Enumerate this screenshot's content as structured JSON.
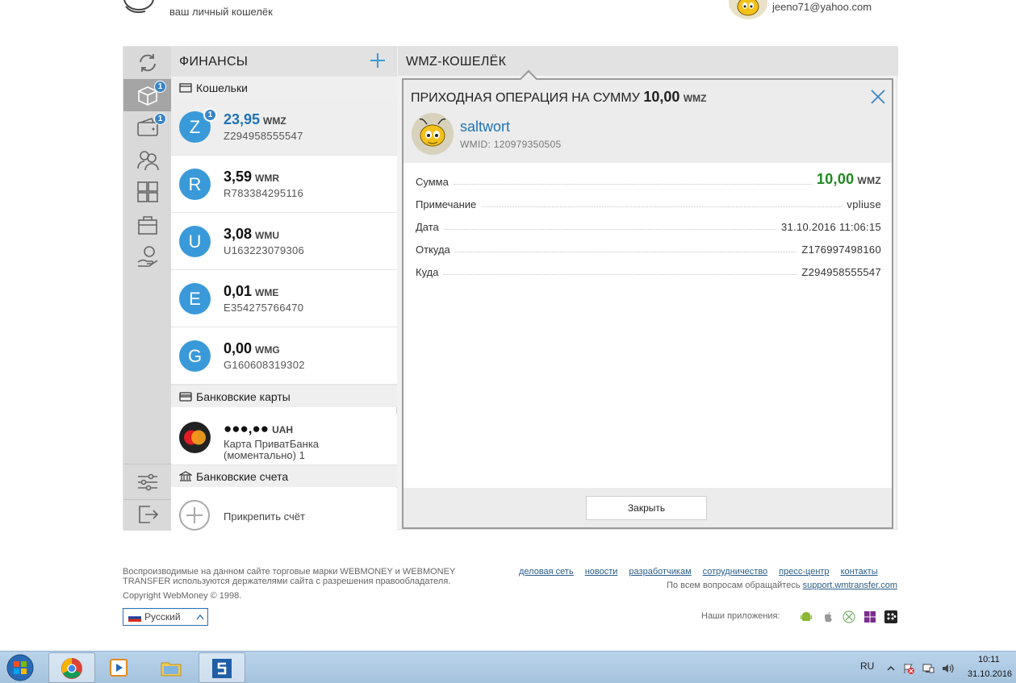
{
  "header": {
    "logo_subtitle": "ваш личный кошелёк",
    "user_email": "jeeno71@yahoo.com"
  },
  "left_bar": {
    "items": [
      {
        "icon": "refresh-icon"
      },
      {
        "icon": "finance-cube-icon",
        "badge": "1",
        "active": true
      },
      {
        "icon": "wallet-icon",
        "badge": "1"
      },
      {
        "icon": "contacts-icon"
      },
      {
        "icon": "services-icon"
      },
      {
        "icon": "shop-icon"
      },
      {
        "icon": "credit-hand-icon"
      },
      {
        "icon": "settings-icon"
      },
      {
        "icon": "logout-icon"
      }
    ]
  },
  "finance": {
    "title": "ФИНАНСЫ",
    "wallets_section": "Кошельки",
    "wallets": [
      {
        "letter": "Z",
        "amount": "23,95",
        "currency": "WMZ",
        "number": "Z294958555547",
        "badge": "1",
        "selected": true
      },
      {
        "letter": "R",
        "amount": "3,59",
        "currency": "WMR",
        "number": "R783384295116"
      },
      {
        "letter": "U",
        "amount": "3,08",
        "currency": "WMU",
        "number": "U163223079306"
      },
      {
        "letter": "E",
        "amount": "0,01",
        "currency": "WME",
        "number": "E354275766470"
      },
      {
        "letter": "G",
        "amount": "0,00",
        "currency": "WMG",
        "number": "G160608319302"
      }
    ],
    "cards_section": "Банковские карты",
    "card": {
      "amount": "●●●,●●",
      "currency": "UAH",
      "name": "Карта ПриватБанка (моментально) 1"
    },
    "accounts_section": "Банковские счета",
    "attach_label": "Прикрепить счёт"
  },
  "main": {
    "title": "WMZ-КОШЕЛЁК"
  },
  "dialog": {
    "title_prefix": "ПРИХОДНАЯ ОПЕРАЦИЯ НА СУММУ",
    "title_amount": "10,00",
    "title_currency": "WMZ",
    "sender_name": "saltwort",
    "sender_wmid": "WMID: 120979350505",
    "rows": {
      "sum_label": "Сумма",
      "sum_value": "10,00",
      "sum_currency": "WMZ",
      "note_label": "Примечание",
      "note_value": "vpliuse",
      "date_label": "Дата",
      "date_value": "31.10.2016 11:06:15",
      "from_label": "Откуда",
      "from_value": "Z176997498160",
      "to_label": "Куда",
      "to_value": "Z294958555547"
    },
    "close_button": "Закрыть"
  },
  "footer": {
    "legal": "Воспроизводимые на данном сайте торговые марки WEBMONEY и WEBMONEY TRANSFER используются держателями сайта с разрешения правообладателя.",
    "copyright": "Copyright WebMoney © 1998.",
    "language": "Русский",
    "links": [
      "деловая сеть",
      "новости",
      "разработчикам",
      "сотрудничество",
      "пресс-центр",
      "контакты"
    ],
    "support_prefix": "По всем вопросам обращайтесь",
    "support_link": "support.wmtransfer.com",
    "apps_label": "Наши приложения:"
  },
  "taskbar": {
    "lang": "RU",
    "time": "10:11",
    "date": "31.10.2016"
  },
  "colors": {
    "accent_blue": "#3a9ad9",
    "amount_green": "#1e8a1e",
    "link_blue": "#1e73b8"
  }
}
